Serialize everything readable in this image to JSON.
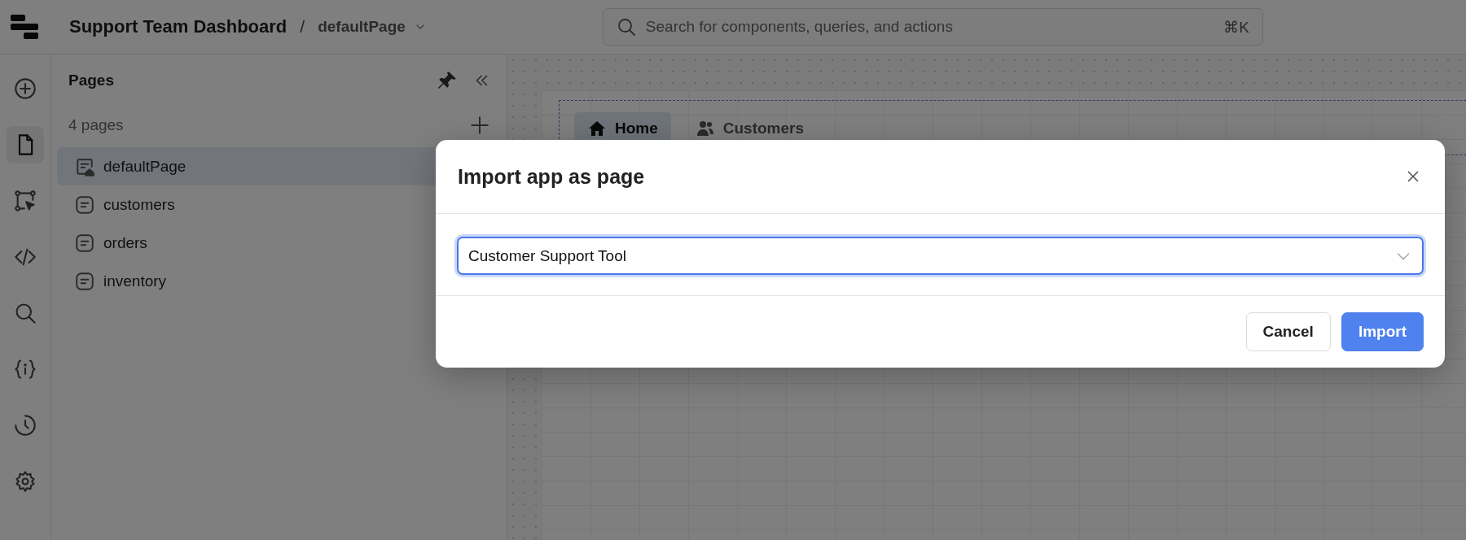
{
  "app": {
    "title": "Support Team Dashboard",
    "separator": "/",
    "page": "defaultPage"
  },
  "search": {
    "placeholder": "Search for components, queries, and actions",
    "shortcut": "⌘K"
  },
  "rail": [
    {
      "kind": "add",
      "selected": false
    },
    {
      "kind": "pages",
      "selected": true
    },
    {
      "kind": "flow",
      "selected": false
    },
    {
      "kind": "code",
      "selected": false
    },
    {
      "kind": "search",
      "selected": false
    },
    {
      "kind": "variables",
      "selected": false
    },
    {
      "kind": "history",
      "selected": false
    },
    {
      "kind": "settings",
      "selected": false
    }
  ],
  "pages_panel": {
    "title": "Pages",
    "count": "4 pages",
    "pages": [
      {
        "name": "defaultPage",
        "kind": "home",
        "selected": true
      },
      {
        "name": "customers",
        "kind": "page",
        "selected": false
      },
      {
        "name": "orders",
        "kind": "page",
        "selected": false
      },
      {
        "name": "inventory",
        "kind": "page",
        "selected": false
      }
    ]
  },
  "canvas": {
    "tabs": [
      {
        "label": "Home",
        "kind": "home",
        "selected": true
      },
      {
        "label": "Customers",
        "kind": "people",
        "selected": false
      }
    ]
  },
  "dialog": {
    "title": "Import app as page",
    "select": {
      "value": "Customer Support Tool"
    },
    "buttons": [
      {
        "label": "Cancel",
        "kind": "secondary"
      },
      {
        "label": "Import",
        "kind": "primary"
      }
    ]
  }
}
